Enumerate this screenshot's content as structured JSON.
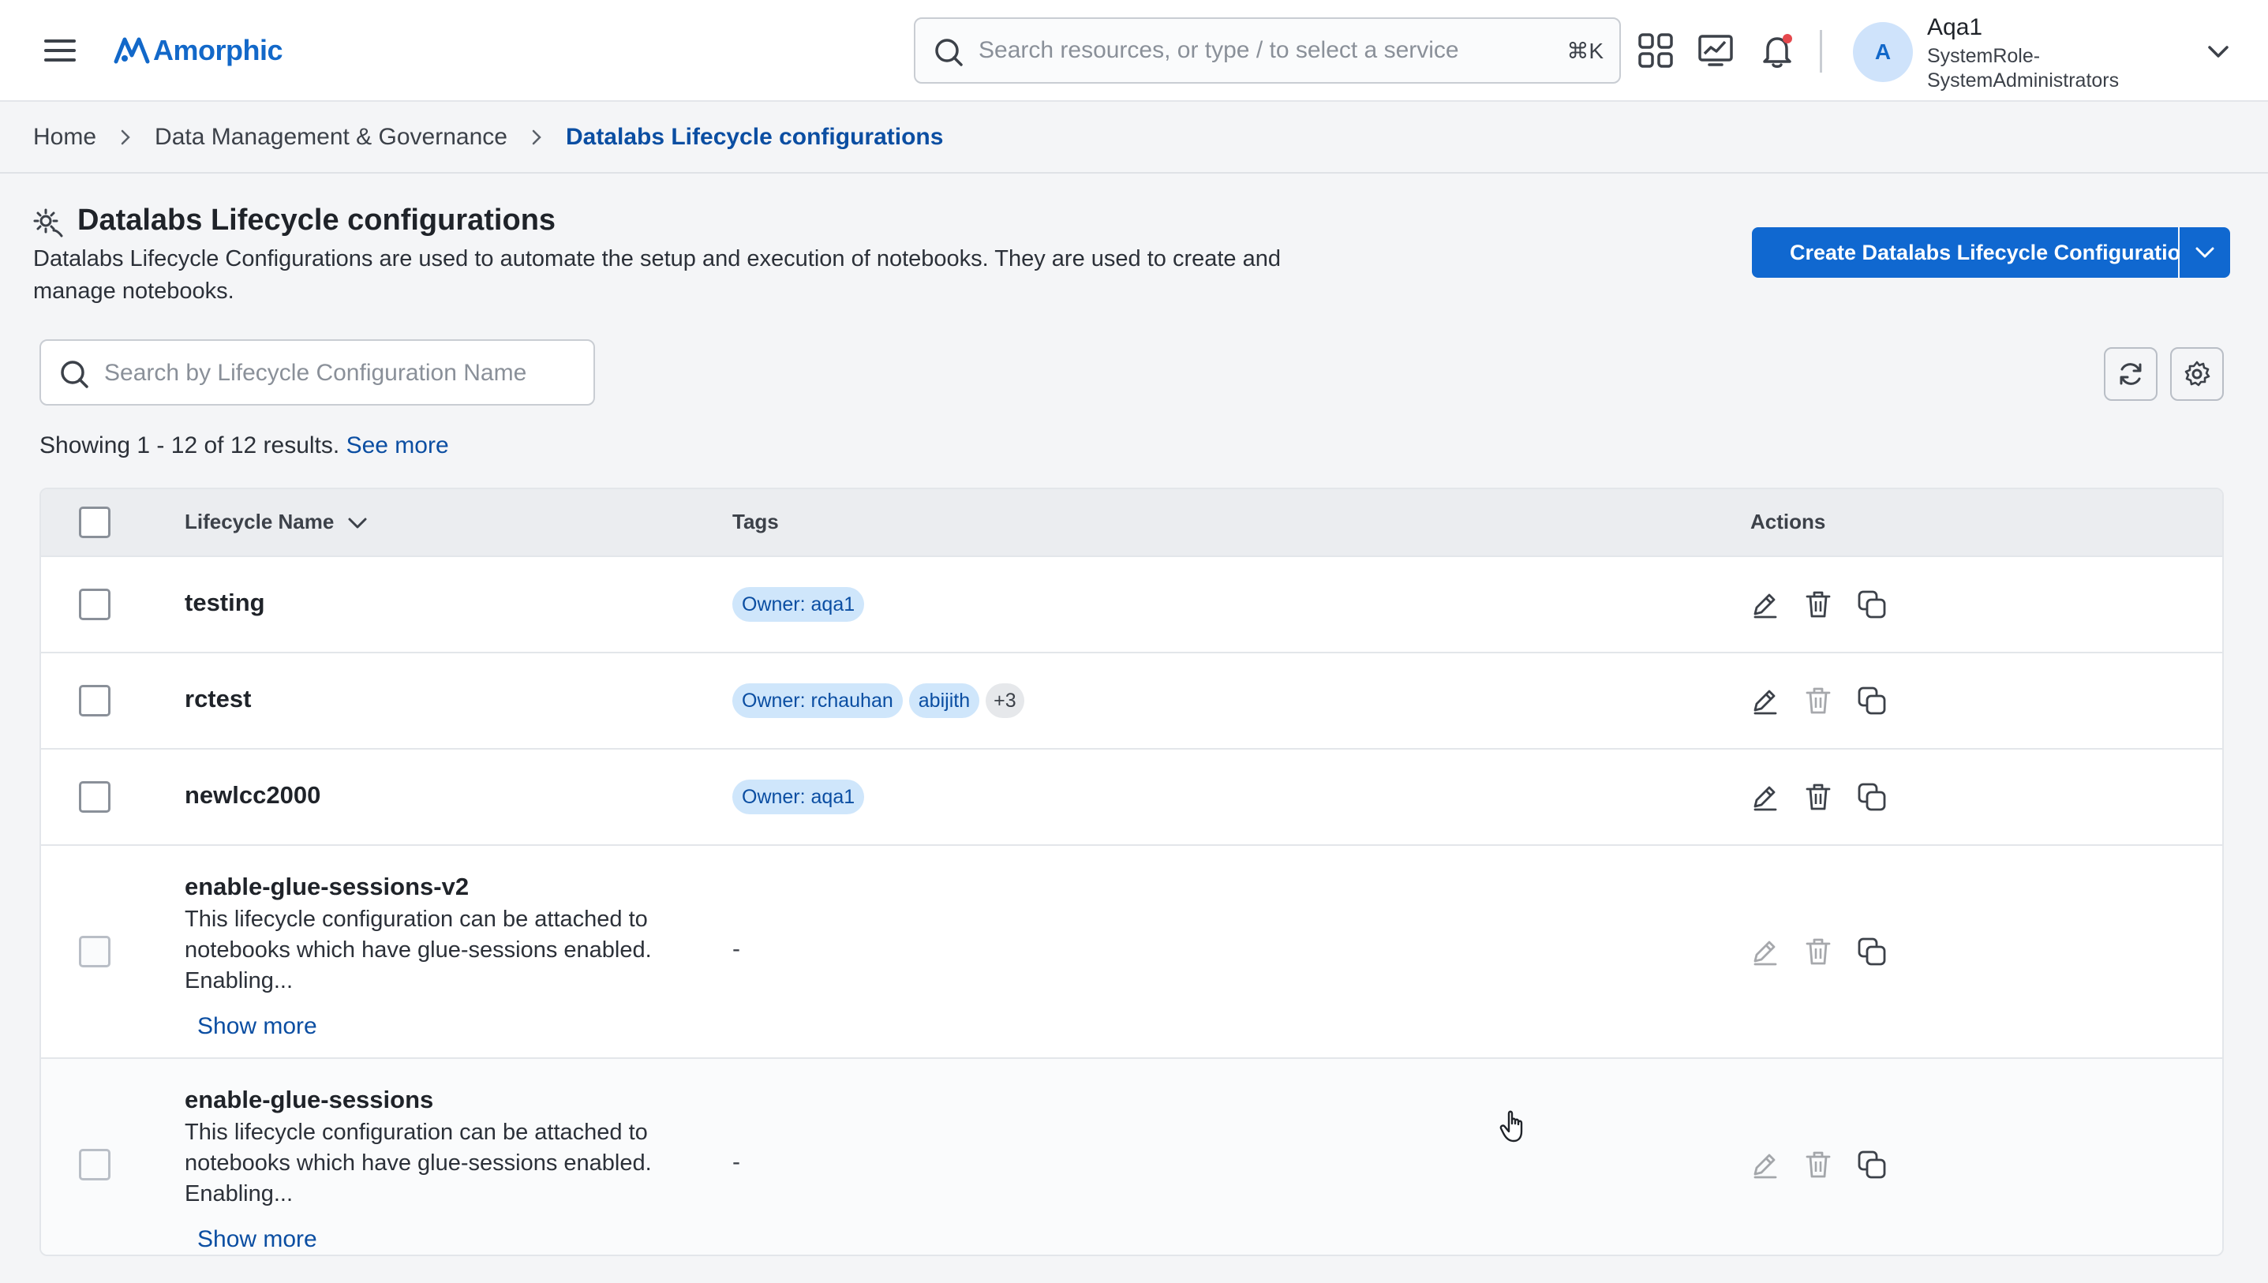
{
  "header": {
    "logo_text": "Amorphic",
    "search_placeholder": "Search resources, or type / to select a service",
    "search_shortcut": "⌘K",
    "icons": [
      "menu-icon",
      "apps-grid-icon",
      "analytics-chart-icon",
      "notification-bell-icon"
    ],
    "notification_dot_color": "#e5484d",
    "user": {
      "initial": "A",
      "name": "Aqa1",
      "role": "SystemRole-SystemAdministrators"
    }
  },
  "breadcrumb": {
    "items": [
      "Home",
      "Data Management & Governance",
      "Datalabs Lifecycle configurations"
    ]
  },
  "page": {
    "title": "Datalabs Lifecycle configurations",
    "description": "Datalabs Lifecycle Configurations are used to automate the setup and execution of notebooks. They are used to create and manage notebooks.",
    "create_button_label": "Create Datalabs Lifecycle Configuration"
  },
  "toolbar": {
    "search_placeholder": "Search by Lifecycle Configuration Name",
    "showing_text": "Showing 1 - 12 of 12 results.",
    "see_more_label": "See more"
  },
  "table": {
    "columns": [
      "Lifecycle Name",
      "Tags",
      "Actions"
    ],
    "rows": [
      {
        "name": "testing",
        "description": "",
        "tags": [
          "Owner: aqa1"
        ],
        "extra_tags": "",
        "show_more": ""
      },
      {
        "name": "rctest",
        "description": "",
        "tags": [
          "Owner: rchauhan",
          "abijith"
        ],
        "extra_tags": "+3",
        "show_more": ""
      },
      {
        "name": "newlcc2000",
        "description": "",
        "tags": [
          "Owner: aqa1"
        ],
        "extra_tags": "",
        "show_more": ""
      },
      {
        "name": "enable-glue-sessions-v2",
        "description": "This lifecycle configuration can be attached to notebooks which have glue-sessions enabled. Enabling...",
        "tags": [],
        "tags_placeholder": "-",
        "extra_tags": "",
        "show_more": "Show more"
      },
      {
        "name": "enable-glue-sessions",
        "description": "This lifecycle configuration can be attached to notebooks which have glue-sessions enabled. Enabling...",
        "tags": [],
        "tags_placeholder": "-",
        "extra_tags": "",
        "show_more": "Show more"
      }
    ],
    "row_actions": [
      "edit-icon",
      "delete-icon",
      "clone-icon"
    ]
  },
  "colors": {
    "primary": "#1068d0",
    "link": "#0b4ea2",
    "tag_bg": "#cfe6fb"
  }
}
